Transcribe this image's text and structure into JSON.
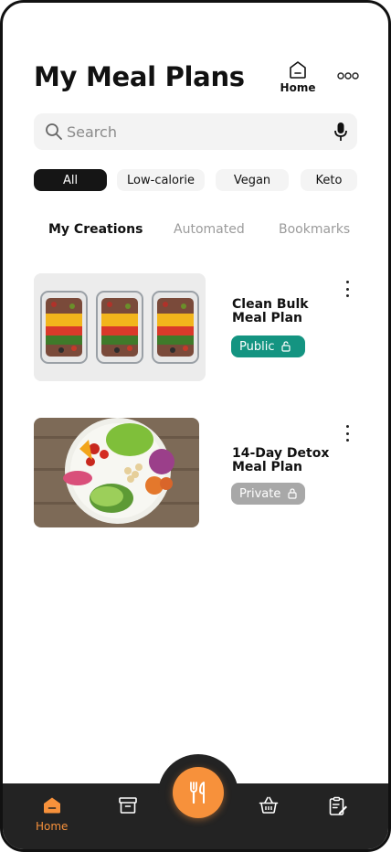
{
  "header": {
    "title": "My Meal Plans",
    "home_label": "Home"
  },
  "search": {
    "placeholder": "Search"
  },
  "filters": [
    {
      "label": "All",
      "active": true
    },
    {
      "label": "Low-calorie",
      "active": false
    },
    {
      "label": "Vegan",
      "active": false
    },
    {
      "label": "Keto",
      "active": false
    }
  ],
  "tabs": [
    {
      "label": "My Creations",
      "active": true
    },
    {
      "label": "Automated",
      "active": false
    },
    {
      "label": "Bookmarks",
      "active": false
    }
  ],
  "meal_plans": [
    {
      "title_line1": "Clean Bulk",
      "title_line2": "Meal Plan",
      "visibility": "Public",
      "badge_color": "#149481",
      "image": "meal-prep-containers"
    },
    {
      "title_line1": "14-Day Detox",
      "title_line2": "Meal Plan",
      "visibility": "Private",
      "badge_color": "#a8a8a8",
      "image": "salad-bowl"
    }
  ],
  "bottom_nav": {
    "home_label": "Home",
    "accent": "#f7913b",
    "icons": [
      "home-icon",
      "archive-icon",
      "utensils-icon",
      "basket-icon",
      "notepad-edit-icon"
    ]
  }
}
